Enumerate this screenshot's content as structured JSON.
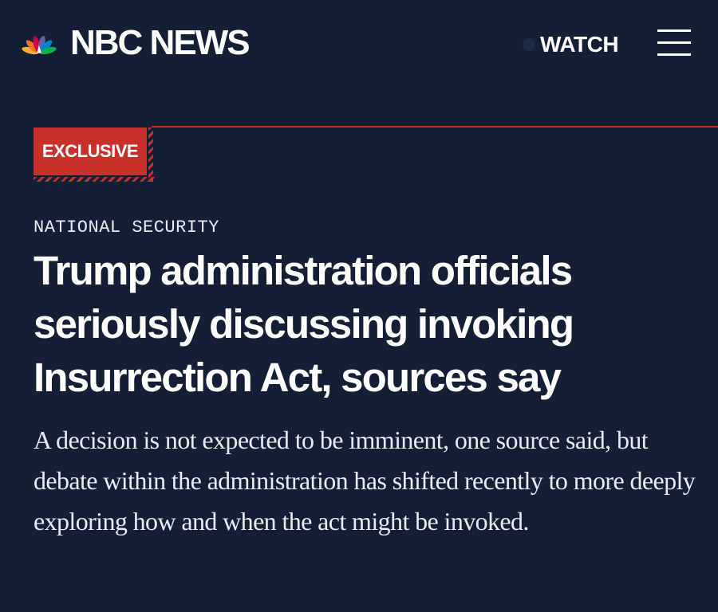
{
  "header": {
    "brand": "NBC NEWS",
    "logo_icon": "nbc-peacock-icon",
    "watch_label": "WATCH",
    "menu_icon": "hamburger-menu-icon"
  },
  "article": {
    "badge": "EXCLUSIVE",
    "section": "NATIONAL SECURITY",
    "headline": "Trump administration officials seriously discussing invoking Insurrection Act, sources say",
    "dek": "A decision is not expected to be imminent, one source said, but debate within the administration has shifted recently to more deeply exploring how and when the act might be invoked."
  },
  "colors": {
    "background": "#141f36",
    "accent": "#c8302a",
    "text": "#ffffff"
  }
}
